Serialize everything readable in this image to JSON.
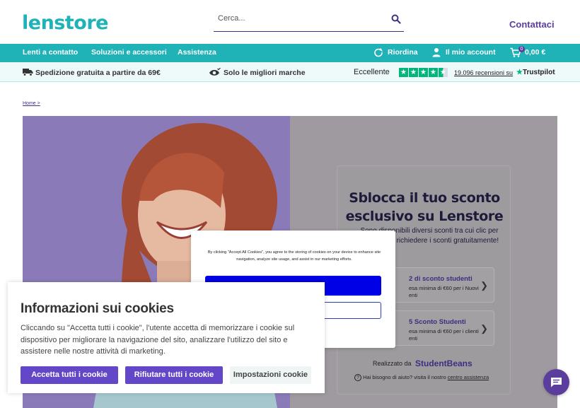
{
  "header": {
    "logo": "lenstore",
    "search_placeholder": "Cerca...",
    "contact": "Contattaci"
  },
  "nav": {
    "items": [
      "Lenti a contatto",
      "Soluzioni e accessori",
      "Assistenza"
    ],
    "reorder": "Riordina",
    "account": "Il mio account",
    "cart_total": "0,00 €",
    "cart_count": "0"
  },
  "benefits": {
    "shipping": "Spedizione gratuita a partire da 69€",
    "brands": "Solo le migliori marche",
    "rating_label": "Eccellente",
    "reviews": "19.096 recensioni su",
    "trustpilot": "Trustpilot"
  },
  "breadcrumb": "Home >",
  "discount_card": {
    "title": "Sblocca il tuo sconto esclusivo su Lenstore",
    "subtitle": "Sono disponibili diversi sconti tra cui clic per verificare e richiedere i sconti gratuitamente!",
    "offers": [
      {
        "title": "2 di sconto studenti",
        "text": "esa minima di €60 per i Nuovi enti"
      },
      {
        "title": "5 Sconto Studenti",
        "text": "esa minima di €60 per i clienti enti"
      }
    ],
    "made_by": "Realizzato da",
    "brand": "StudentBeans",
    "help": "Hai bisogno di aiuto? visita il nostro",
    "help_link": "centro assistenza"
  },
  "consent": {
    "text": "By clicking \"Accept All Cookies\", you agree to the storing of cookies on your device to enhance site navigation, analyze site usage, and assist in our marketing efforts.",
    "settings_fragment": "s"
  },
  "cookie_box": {
    "title": "Informazioni sui cookies",
    "text": "Cliccando su \"Accetta tutti i cookie\", l'utente accetta di memorizzare i cookie sul dispositivo per migliorare la navigazione del sito, analizzare l'utilizzo del sito e assistere nelle nostre attività di marketing.",
    "accept_all": "Accetta tutti i cookie",
    "reject_all": "Rifiutare tutti i cookie",
    "settings": "Impostazioni cookie"
  },
  "colors": {
    "brand_teal": "#1fb2b7",
    "brand_purple": "#5b3d9e",
    "cookie_button": "#6347c8",
    "trustpilot_green": "#00b67a"
  }
}
